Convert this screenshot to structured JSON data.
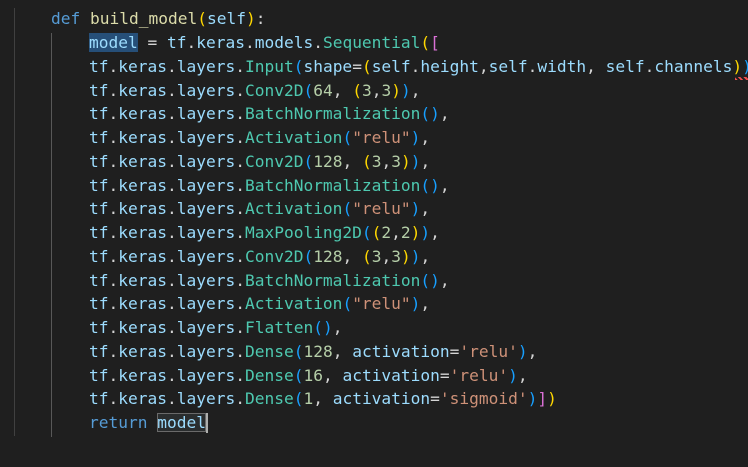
{
  "editor": {
    "background": "#1f1f1f",
    "theme": "dark",
    "lines": [
      {
        "tokens": [
          {
            "t": "def",
            "c": "kw"
          },
          {
            "t": " ",
            "c": "plain"
          },
          {
            "t": "build_model",
            "c": "fn"
          },
          {
            "t": "(",
            "c": "p1"
          },
          {
            "t": "self",
            "c": "var"
          },
          {
            "t": ")",
            "c": "p1"
          },
          {
            "t": ":",
            "c": "plain"
          }
        ]
      },
      {
        "tokens": [
          {
            "t": "model",
            "c": "var",
            "hl": true
          },
          {
            "t": " = ",
            "c": "plain"
          },
          {
            "t": "tf",
            "c": "var"
          },
          {
            "t": ".",
            "c": "plain"
          },
          {
            "t": "keras",
            "c": "var"
          },
          {
            "t": ".",
            "c": "plain"
          },
          {
            "t": "models",
            "c": "var"
          },
          {
            "t": ".",
            "c": "plain"
          },
          {
            "t": "Sequential",
            "c": "cls"
          },
          {
            "t": "(",
            "c": "p1"
          },
          {
            "t": "[",
            "c": "p2"
          }
        ]
      },
      {
        "tokens": [
          {
            "t": "tf",
            "c": "var"
          },
          {
            "t": ".",
            "c": "plain"
          },
          {
            "t": "keras",
            "c": "var"
          },
          {
            "t": ".",
            "c": "plain"
          },
          {
            "t": "layers",
            "c": "var"
          },
          {
            "t": ".",
            "c": "plain"
          },
          {
            "t": "Input",
            "c": "cls"
          },
          {
            "t": "(",
            "c": "p3"
          },
          {
            "t": "shape",
            "c": "var"
          },
          {
            "t": "=",
            "c": "plain"
          },
          {
            "t": "(",
            "c": "p1"
          },
          {
            "t": "self",
            "c": "var"
          },
          {
            "t": ".",
            "c": "plain"
          },
          {
            "t": "height",
            "c": "var"
          },
          {
            "t": ",",
            "c": "plain"
          },
          {
            "t": "self",
            "c": "var"
          },
          {
            "t": ".",
            "c": "plain"
          },
          {
            "t": "width",
            "c": "var"
          },
          {
            "t": ", ",
            "c": "plain"
          },
          {
            "t": "self",
            "c": "var"
          },
          {
            "t": ".",
            "c": "plain"
          },
          {
            "t": "channels",
            "c": "var"
          },
          {
            "t": ")",
            "c": "p1"
          },
          {
            "t": ")",
            "c": "p3"
          }
        ]
      },
      {
        "tokens": [
          {
            "t": "tf",
            "c": "var"
          },
          {
            "t": ".",
            "c": "plain"
          },
          {
            "t": "keras",
            "c": "var"
          },
          {
            "t": ".",
            "c": "plain"
          },
          {
            "t": "layers",
            "c": "var"
          },
          {
            "t": ".",
            "c": "plain"
          },
          {
            "t": "Conv2D",
            "c": "cls"
          },
          {
            "t": "(",
            "c": "p3"
          },
          {
            "t": "64",
            "c": "num"
          },
          {
            "t": ", ",
            "c": "plain"
          },
          {
            "t": "(",
            "c": "p1"
          },
          {
            "t": "3",
            "c": "num"
          },
          {
            "t": ",",
            "c": "plain"
          },
          {
            "t": "3",
            "c": "num"
          },
          {
            "t": ")",
            "c": "p1"
          },
          {
            "t": ")",
            "c": "p3"
          },
          {
            "t": ",",
            "c": "plain"
          }
        ]
      },
      {
        "tokens": [
          {
            "t": "tf",
            "c": "var"
          },
          {
            "t": ".",
            "c": "plain"
          },
          {
            "t": "keras",
            "c": "var"
          },
          {
            "t": ".",
            "c": "plain"
          },
          {
            "t": "layers",
            "c": "var"
          },
          {
            "t": ".",
            "c": "plain"
          },
          {
            "t": "BatchNormalization",
            "c": "cls"
          },
          {
            "t": "(",
            "c": "p3"
          },
          {
            "t": ")",
            "c": "p3"
          },
          {
            "t": ",",
            "c": "plain"
          }
        ]
      },
      {
        "tokens": [
          {
            "t": "tf",
            "c": "var"
          },
          {
            "t": ".",
            "c": "plain"
          },
          {
            "t": "keras",
            "c": "var"
          },
          {
            "t": ".",
            "c": "plain"
          },
          {
            "t": "layers",
            "c": "var"
          },
          {
            "t": ".",
            "c": "plain"
          },
          {
            "t": "Activation",
            "c": "cls"
          },
          {
            "t": "(",
            "c": "p3"
          },
          {
            "t": "\"relu\"",
            "c": "str"
          },
          {
            "t": ")",
            "c": "p3"
          },
          {
            "t": ",",
            "c": "plain"
          }
        ]
      },
      {
        "tokens": [
          {
            "t": "tf",
            "c": "var"
          },
          {
            "t": ".",
            "c": "plain"
          },
          {
            "t": "keras",
            "c": "var"
          },
          {
            "t": ".",
            "c": "plain"
          },
          {
            "t": "layers",
            "c": "var"
          },
          {
            "t": ".",
            "c": "plain"
          },
          {
            "t": "Conv2D",
            "c": "cls"
          },
          {
            "t": "(",
            "c": "p3"
          },
          {
            "t": "128",
            "c": "num"
          },
          {
            "t": ", ",
            "c": "plain"
          },
          {
            "t": "(",
            "c": "p1"
          },
          {
            "t": "3",
            "c": "num"
          },
          {
            "t": ",",
            "c": "plain"
          },
          {
            "t": "3",
            "c": "num"
          },
          {
            "t": ")",
            "c": "p1"
          },
          {
            "t": ")",
            "c": "p3"
          },
          {
            "t": ",",
            "c": "plain"
          }
        ]
      },
      {
        "tokens": [
          {
            "t": "tf",
            "c": "var"
          },
          {
            "t": ".",
            "c": "plain"
          },
          {
            "t": "keras",
            "c": "var"
          },
          {
            "t": ".",
            "c": "plain"
          },
          {
            "t": "layers",
            "c": "var"
          },
          {
            "t": ".",
            "c": "plain"
          },
          {
            "t": "BatchNormalization",
            "c": "cls"
          },
          {
            "t": "(",
            "c": "p3"
          },
          {
            "t": ")",
            "c": "p3"
          },
          {
            "t": ",",
            "c": "plain"
          }
        ]
      },
      {
        "tokens": [
          {
            "t": "tf",
            "c": "var"
          },
          {
            "t": ".",
            "c": "plain"
          },
          {
            "t": "keras",
            "c": "var"
          },
          {
            "t": ".",
            "c": "plain"
          },
          {
            "t": "layers",
            "c": "var"
          },
          {
            "t": ".",
            "c": "plain"
          },
          {
            "t": "Activation",
            "c": "cls"
          },
          {
            "t": "(",
            "c": "p3"
          },
          {
            "t": "\"relu\"",
            "c": "str"
          },
          {
            "t": ")",
            "c": "p3"
          },
          {
            "t": ",",
            "c": "plain"
          }
        ]
      },
      {
        "tokens": [
          {
            "t": "tf",
            "c": "var"
          },
          {
            "t": ".",
            "c": "plain"
          },
          {
            "t": "keras",
            "c": "var"
          },
          {
            "t": ".",
            "c": "plain"
          },
          {
            "t": "layers",
            "c": "var"
          },
          {
            "t": ".",
            "c": "plain"
          },
          {
            "t": "MaxPooling2D",
            "c": "cls"
          },
          {
            "t": "(",
            "c": "p3"
          },
          {
            "t": "(",
            "c": "p1"
          },
          {
            "t": "2",
            "c": "num"
          },
          {
            "t": ",",
            "c": "plain"
          },
          {
            "t": "2",
            "c": "num"
          },
          {
            "t": ")",
            "c": "p1"
          },
          {
            "t": ")",
            "c": "p3"
          },
          {
            "t": ",",
            "c": "plain"
          }
        ]
      },
      {
        "tokens": [
          {
            "t": "tf",
            "c": "var"
          },
          {
            "t": ".",
            "c": "plain"
          },
          {
            "t": "keras",
            "c": "var"
          },
          {
            "t": ".",
            "c": "plain"
          },
          {
            "t": "layers",
            "c": "var"
          },
          {
            "t": ".",
            "c": "plain"
          },
          {
            "t": "Conv2D",
            "c": "cls"
          },
          {
            "t": "(",
            "c": "p3"
          },
          {
            "t": "128",
            "c": "num"
          },
          {
            "t": ", ",
            "c": "plain"
          },
          {
            "t": "(",
            "c": "p1"
          },
          {
            "t": "3",
            "c": "num"
          },
          {
            "t": ",",
            "c": "plain"
          },
          {
            "t": "3",
            "c": "num"
          },
          {
            "t": ")",
            "c": "p1"
          },
          {
            "t": ")",
            "c": "p3"
          },
          {
            "t": ",",
            "c": "plain"
          }
        ]
      },
      {
        "tokens": [
          {
            "t": "tf",
            "c": "var"
          },
          {
            "t": ".",
            "c": "plain"
          },
          {
            "t": "keras",
            "c": "var"
          },
          {
            "t": ".",
            "c": "plain"
          },
          {
            "t": "layers",
            "c": "var"
          },
          {
            "t": ".",
            "c": "plain"
          },
          {
            "t": "BatchNormalization",
            "c": "cls"
          },
          {
            "t": "(",
            "c": "p3"
          },
          {
            "t": ")",
            "c": "p3"
          },
          {
            "t": ",",
            "c": "plain"
          }
        ]
      },
      {
        "tokens": [
          {
            "t": "tf",
            "c": "var"
          },
          {
            "t": ".",
            "c": "plain"
          },
          {
            "t": "keras",
            "c": "var"
          },
          {
            "t": ".",
            "c": "plain"
          },
          {
            "t": "layers",
            "c": "var"
          },
          {
            "t": ".",
            "c": "plain"
          },
          {
            "t": "Activation",
            "c": "cls"
          },
          {
            "t": "(",
            "c": "p3"
          },
          {
            "t": "\"relu\"",
            "c": "str"
          },
          {
            "t": ")",
            "c": "p3"
          },
          {
            "t": ",",
            "c": "plain"
          }
        ]
      },
      {
        "tokens": [
          {
            "t": "tf",
            "c": "var"
          },
          {
            "t": ".",
            "c": "plain"
          },
          {
            "t": "keras",
            "c": "var"
          },
          {
            "t": ".",
            "c": "plain"
          },
          {
            "t": "layers",
            "c": "var"
          },
          {
            "t": ".",
            "c": "plain"
          },
          {
            "t": "Flatten",
            "c": "cls"
          },
          {
            "t": "(",
            "c": "p3"
          },
          {
            "t": ")",
            "c": "p3"
          },
          {
            "t": ",",
            "c": "plain"
          }
        ]
      },
      {
        "tokens": [
          {
            "t": "tf",
            "c": "var"
          },
          {
            "t": ".",
            "c": "plain"
          },
          {
            "t": "keras",
            "c": "var"
          },
          {
            "t": ".",
            "c": "plain"
          },
          {
            "t": "layers",
            "c": "var"
          },
          {
            "t": ".",
            "c": "plain"
          },
          {
            "t": "Dense",
            "c": "cls"
          },
          {
            "t": "(",
            "c": "p3"
          },
          {
            "t": "128",
            "c": "num"
          },
          {
            "t": ", ",
            "c": "plain"
          },
          {
            "t": "activation",
            "c": "var"
          },
          {
            "t": "=",
            "c": "plain"
          },
          {
            "t": "'relu'",
            "c": "str"
          },
          {
            "t": ")",
            "c": "p3"
          },
          {
            "t": ",",
            "c": "plain"
          }
        ]
      },
      {
        "tokens": [
          {
            "t": "tf",
            "c": "var"
          },
          {
            "t": ".",
            "c": "plain"
          },
          {
            "t": "keras",
            "c": "var"
          },
          {
            "t": ".",
            "c": "plain"
          },
          {
            "t": "layers",
            "c": "var"
          },
          {
            "t": ".",
            "c": "plain"
          },
          {
            "t": "Dense",
            "c": "cls"
          },
          {
            "t": "(",
            "c": "p3"
          },
          {
            "t": "16",
            "c": "num"
          },
          {
            "t": ", ",
            "c": "plain"
          },
          {
            "t": "activation",
            "c": "var"
          },
          {
            "t": "=",
            "c": "plain"
          },
          {
            "t": "'relu'",
            "c": "str"
          },
          {
            "t": ")",
            "c": "p3"
          },
          {
            "t": ",",
            "c": "plain"
          }
        ]
      },
      {
        "tokens": [
          {
            "t": "tf",
            "c": "var"
          },
          {
            "t": ".",
            "c": "plain"
          },
          {
            "t": "keras",
            "c": "var"
          },
          {
            "t": ".",
            "c": "plain"
          },
          {
            "t": "layers",
            "c": "var"
          },
          {
            "t": ".",
            "c": "plain"
          },
          {
            "t": "Dense",
            "c": "cls"
          },
          {
            "t": "(",
            "c": "p3"
          },
          {
            "t": "1",
            "c": "num"
          },
          {
            "t": ", ",
            "c": "plain"
          },
          {
            "t": "activation",
            "c": "var"
          },
          {
            "t": "=",
            "c": "plain"
          },
          {
            "t": "'sigmoid'",
            "c": "str"
          },
          {
            "t": ")",
            "c": "p3"
          },
          {
            "t": "]",
            "c": "p2"
          },
          {
            "t": ")",
            "c": "p1"
          }
        ]
      },
      {
        "tokens": [
          {
            "t": "return",
            "c": "kw"
          },
          {
            "t": " ",
            "c": "plain"
          },
          {
            "t": "model",
            "c": "var",
            "box": true
          }
        ]
      }
    ]
  }
}
